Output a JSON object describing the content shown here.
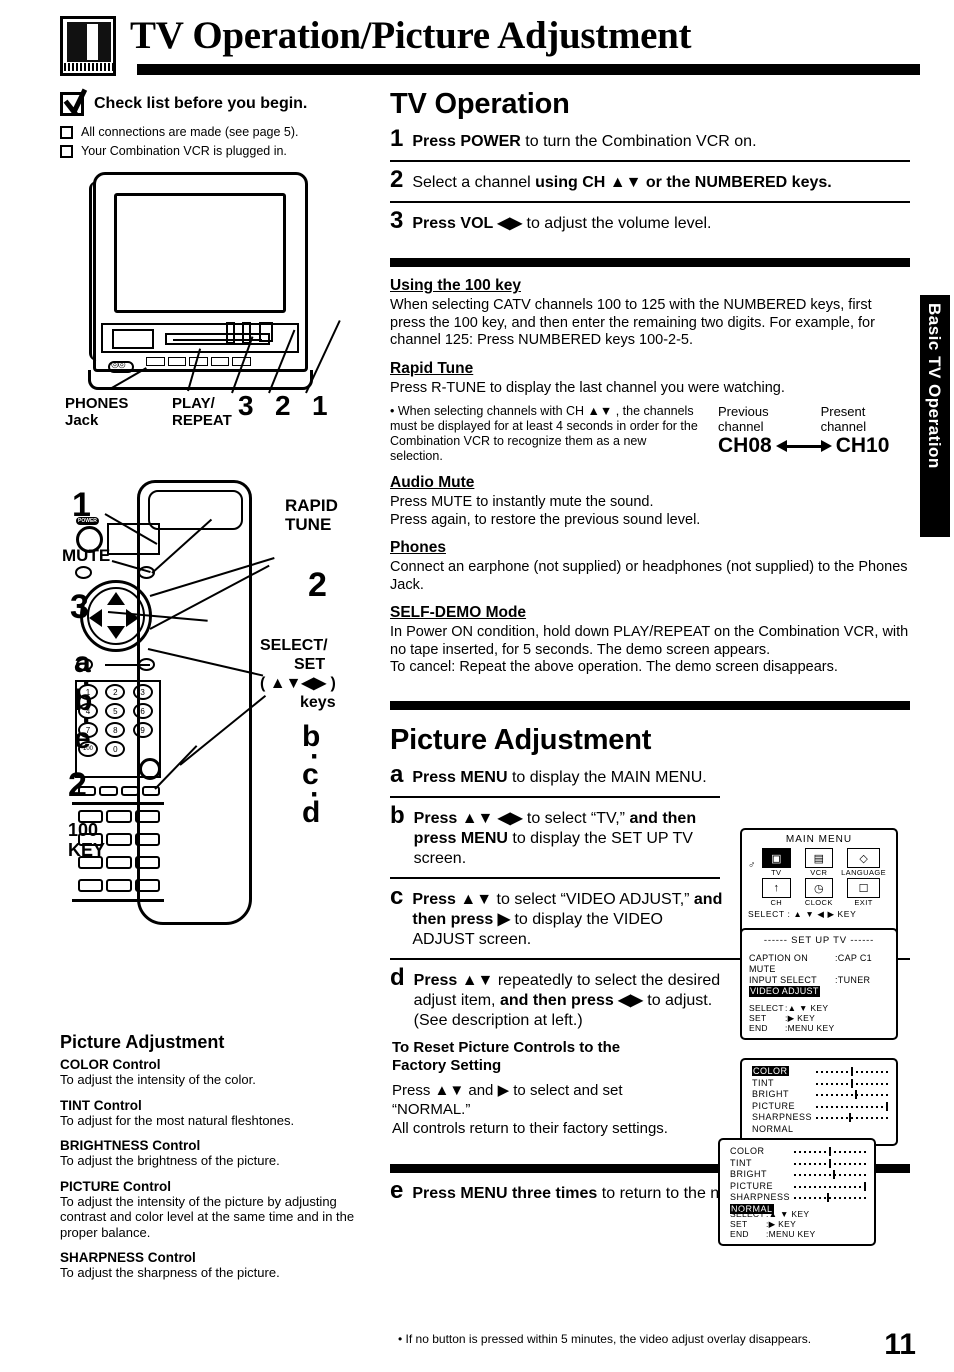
{
  "header": {
    "title": "TV Operation/Picture Adjustment",
    "icon": "tv-vcr-icon"
  },
  "side_tab": {
    "label": "Basic TV Operation"
  },
  "checklist": {
    "heading": "Check list before you begin.",
    "items": [
      "All connections are made (see page 5).",
      "Your Combination VCR is plugged in."
    ]
  },
  "tv_illustration": {
    "labels": {
      "phones": "PHONES",
      "phones2": "Jack",
      "play": "PLAY/",
      "play2": "REPEAT",
      "n3": "3",
      "n2": "2",
      "n1": "1"
    }
  },
  "remote_illustration": {
    "callouts": {
      "one": "1",
      "mute": "MUTE",
      "three": "3",
      "a": "a",
      "dot1": "·",
      "b": "b",
      "dot2": "·",
      "e": "e",
      "two_left": "2",
      "key100_l1": "100",
      "key100_l2": "KEY",
      "rapid1": "RAPID",
      "rapid2": "TUNE",
      "two_right": "2",
      "select1": "SELECT/",
      "select2": "SET",
      "select3": "( ▲▼◀▶ )",
      "select4": "keys",
      "b_right": "b",
      "rdot1": "·",
      "c_right": "c",
      "rdot2": "·",
      "d_right": "d"
    },
    "keypad": [
      "1",
      "2",
      "3",
      "4",
      "5",
      "6",
      "7",
      "8",
      "9",
      "100",
      "0"
    ]
  },
  "tv_operation": {
    "title": "TV Operation",
    "steps": [
      {
        "num": "1",
        "parts": [
          {
            "t": "Press POWER",
            "bold": true
          },
          {
            "t": " to turn the Combination VCR on.",
            "bold": false
          }
        ]
      },
      {
        "num": "2",
        "parts": [
          {
            "t": "Select a channel ",
            "bold": false
          },
          {
            "t": "using CH ▲▼ or the NUMBERED keys.",
            "bold": true
          }
        ]
      },
      {
        "num": "3",
        "parts": [
          {
            "t": "Press VOL ◀▶",
            "bold": true
          },
          {
            "t": " to adjust the volume level.",
            "bold": false
          }
        ]
      }
    ],
    "sections": [
      {
        "heading": "Using the 100 key",
        "body": "When selecting CATV channels 100 to 125 with the NUMBERED keys, first press the 100 key, and then enter the remaining two digits. For example, for channel 125: Press NUMBERED keys 100-2-5."
      },
      {
        "heading": "Rapid Tune",
        "body": "Press R-TUNE to display the last channel you were watching."
      }
    ],
    "rapid_note": {
      "bullet": "• When selecting channels with CH ▲▼ , the channels must be displayed for at least 4 seconds in order for the Combination VCR to recognize them as a new selection.",
      "prev_label1": "Previous",
      "prev_label2": "channel",
      "pres_label1": "Present",
      "pres_label2": "channel",
      "prev_channel": "CH08",
      "present_channel": "CH10"
    },
    "sections2": [
      {
        "heading": "Audio Mute",
        "body": "Press MUTE to instantly mute the sound.\nPress again, to restore the previous sound level."
      },
      {
        "heading": "Phones",
        "body": "Connect an earphone (not supplied) or headphones (not supplied) to the Phones Jack."
      },
      {
        "heading": "SELF-DEMO Mode",
        "body": "In Power ON condition, hold down PLAY/REPEAT on the Combination VCR, with no tape inserted, for 5 seconds. The demo screen appears.\nTo cancel: Repeat the above operation. The demo screen disappears."
      }
    ]
  },
  "picture_adjustment_right": {
    "title": "Picture Adjustment",
    "steps": [
      {
        "letter": "a",
        "parts": [
          {
            "t": "Press MENU",
            "bold": true
          },
          {
            "t": " to display the MAIN MENU.",
            "bold": false
          }
        ]
      },
      {
        "letter": "b",
        "parts": [
          {
            "t": "Press ▲▼ ◀▶",
            "bold": true
          },
          {
            "t": " to select “TV,” ",
            "bold": false
          },
          {
            "t": "and then press MENU",
            "bold": true
          },
          {
            "t": " to display the SET UP TV screen.",
            "bold": false
          }
        ]
      },
      {
        "letter": "c",
        "parts": [
          {
            "t": "Press ▲▼",
            "bold": true
          },
          {
            "t": " to select “VIDEO ADJUST,” ",
            "bold": false
          },
          {
            "t": "and then press ▶",
            "bold": true
          },
          {
            "t": " to display the VIDEO ADJUST screen.",
            "bold": false
          }
        ]
      },
      {
        "letter": "d",
        "parts": [
          {
            "t": "Press ▲▼",
            "bold": true
          },
          {
            "t": " repeatedly to select the desired adjust item, ",
            "bold": false
          },
          {
            "t": "and then press ◀▶",
            "bold": true
          },
          {
            "t": " to adjust. (See description at left.)",
            "bold": false
          }
        ]
      }
    ],
    "reset": {
      "heading1": "To Reset Picture Controls to the",
      "heading2": "Factory Setting",
      "body1": "Press ▲▼ and ▶ to select and set",
      "body2": "“NORMAL.”",
      "body3": "All controls return to their factory settings."
    },
    "step_e": {
      "letter": "e",
      "bold": "Press MENU three times",
      "rest": " to return to the normal screen."
    },
    "footnote": "• If no button is pressed within 5 minutes, the video adjust overlay disappears."
  },
  "picture_adjustment_left": {
    "title": "Picture Adjustment",
    "controls": [
      {
        "name": "COLOR Control",
        "desc": "To adjust the intensity of the color."
      },
      {
        "name": "TINT Control",
        "desc": "To adjust for the most natural fleshtones."
      },
      {
        "name": "BRIGHTNESS Control",
        "desc": "To adjust the brightness of the picture."
      },
      {
        "name": "PICTURE Control",
        "desc": "To adjust the intensity of the picture by adjusting contrast and color level at the same time and in the proper balance."
      },
      {
        "name": "SHARPNESS Control",
        "desc": "To adjust the sharpness of the picture."
      }
    ]
  },
  "osd": {
    "main_menu": {
      "title": "MAIN MENU",
      "cursor": "♂",
      "items": [
        {
          "label": "TV",
          "glyph": "▣",
          "selected": true
        },
        {
          "label": "VCR",
          "glyph": "▤",
          "selected": false
        },
        {
          "label": "LANGUAGE",
          "glyph": "◇",
          "selected": false
        },
        {
          "label": "CH",
          "glyph": "↑",
          "selected": false
        },
        {
          "label": "CLOCK",
          "glyph": "◷",
          "selected": false
        },
        {
          "label": "EXIT",
          "glyph": "☐",
          "selected": false
        }
      ],
      "select_line": "SELECT : ▲ ▼ ◀ ▶ KEY"
    },
    "setup_tv": {
      "title": "------ SET UP TV ------",
      "rows": [
        {
          "key": "CAPTION ON MUTE",
          "val": ":CAP C1",
          "highlight": false
        },
        {
          "key": "INPUT SELECT",
          "val": ":TUNER",
          "highlight": false
        },
        {
          "key": "VIDEO ADJUST",
          "val": "",
          "highlight": true
        }
      ],
      "foot": [
        {
          "k": "SELECT",
          "v": ":▲ ▼ KEY"
        },
        {
          "k": "SET",
          "v": ":▶ KEY"
        },
        {
          "k": "END",
          "v": ":MENU KEY"
        }
      ]
    },
    "video_adjust_1": {
      "rows": [
        {
          "name": "COLOR",
          "highlight": true,
          "value": 50
        },
        {
          "name": "TINT",
          "highlight": false,
          "value": 50
        },
        {
          "name": "BRIGHT",
          "highlight": false,
          "value": 55
        },
        {
          "name": "PICTURE",
          "highlight": false,
          "value": 100
        },
        {
          "name": "SHARPNESS",
          "highlight": false,
          "value": 48
        },
        {
          "name": "NORMAL",
          "highlight": false,
          "value": null
        }
      ]
    },
    "video_adjust_2": {
      "rows": [
        {
          "name": "COLOR",
          "highlight": false,
          "value": 50
        },
        {
          "name": "TINT",
          "highlight": false,
          "value": 50
        },
        {
          "name": "BRIGHT",
          "highlight": false,
          "value": 55
        },
        {
          "name": "PICTURE",
          "highlight": false,
          "value": 100
        },
        {
          "name": "SHARPNESS",
          "highlight": false,
          "value": 48
        },
        {
          "name": "NORMAL",
          "highlight": true,
          "value": null
        }
      ],
      "foot": [
        {
          "k": "SELECT",
          "v": ":▲ ▼ KEY"
        },
        {
          "k": "SET",
          "v": ":▶ KEY"
        },
        {
          "k": "END",
          "v": ":MENU KEY"
        }
      ]
    }
  },
  "page_number": "11"
}
